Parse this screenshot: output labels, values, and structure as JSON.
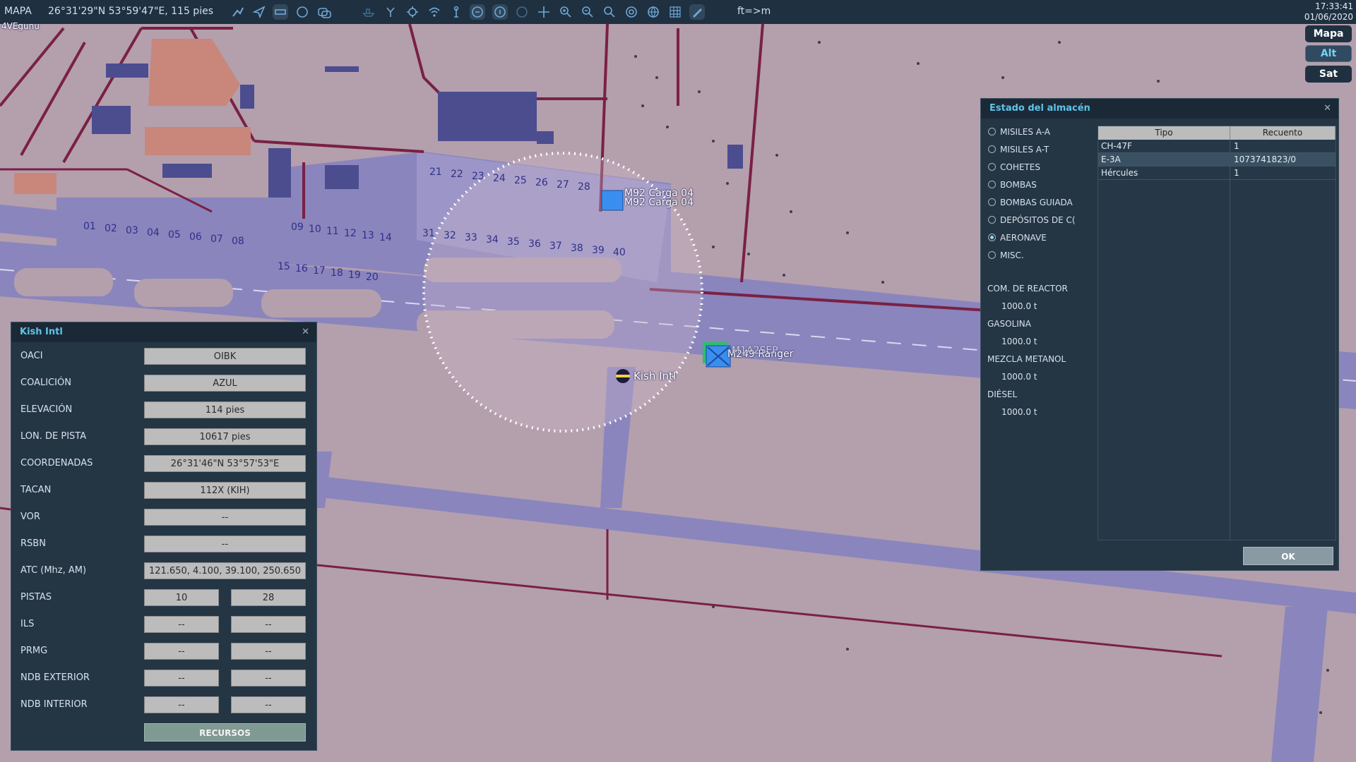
{
  "topbar": {
    "app_title": "MAPA",
    "cursor_position": "26°31'29\"N 53°59'47\"E, 115 pies",
    "unit_toggle": "ft=>m",
    "time": "17:33:41",
    "date": "01/06/2020"
  },
  "map": {
    "mode_buttons": {
      "map": "Mapa",
      "alt": "Alt",
      "sat": "Sat",
      "active": "Alt"
    },
    "corner_label": "4VEgunu",
    "airfield_label": "Kish Intl",
    "unit_labels": [
      "M92 Carga 04",
      "M92 Carga 04",
      "M249 Ranger",
      "M1A2SEP"
    ],
    "parking_spots": [
      "01",
      "02",
      "03",
      "04",
      "05",
      "06",
      "07",
      "08",
      "09",
      "10",
      "11",
      "12",
      "13",
      "14",
      "15",
      "16",
      "17",
      "18",
      "19",
      "20",
      "21",
      "22",
      "23",
      "24",
      "25",
      "26",
      "27",
      "28",
      "31",
      "32",
      "33",
      "34",
      "35",
      "36",
      "37",
      "38",
      "39",
      "40"
    ],
    "colors": {
      "terrain": "#b49fad",
      "apron": "#8a85bd",
      "roads": "#7a2045",
      "buildings": "#4c4d8f"
    }
  },
  "airport_panel": {
    "title": "Kish Intl",
    "fields": {
      "oaci": {
        "label": "OACI",
        "value": "OIBK"
      },
      "coalition": {
        "label": "COALICIÓN",
        "value": "AZUL"
      },
      "elevation": {
        "label": "ELEVACIÓN",
        "value": "114 pies"
      },
      "runway_length": {
        "label": "LON. DE PISTA",
        "value": "10617 pies"
      },
      "coordinates": {
        "label": "COORDENADAS",
        "value": "26°31'46\"N 53°57'53\"E"
      },
      "tacan": {
        "label": "TACAN",
        "value": "112X (KIH)"
      },
      "vor": {
        "label": "VOR",
        "value": "--"
      },
      "rsbn": {
        "label": "RSBN",
        "value": "--"
      },
      "atc": {
        "label": "ATC  (Mhz, AM)",
        "value": "121.650, 4.100, 39.100, 250.650"
      },
      "runways": {
        "label": "PISTAS",
        "value_a": "10",
        "value_b": "28"
      },
      "ils": {
        "label": "ILS",
        "value_a": "--",
        "value_b": "--"
      },
      "prmg": {
        "label": "PRMG",
        "value_a": "--",
        "value_b": "--"
      },
      "ndb_outer": {
        "label": "NDB EXTERIOR",
        "value_a": "--",
        "value_b": "--"
      },
      "ndb_inner": {
        "label": "NDB INTERIOR",
        "value_a": "--",
        "value_b": "--"
      }
    },
    "resources_button": "RECURSOS"
  },
  "warehouse_panel": {
    "title": "Estado del almacén",
    "categories": [
      {
        "label": "MISILES A-A",
        "selected": false
      },
      {
        "label": "MISILES A-T",
        "selected": false
      },
      {
        "label": "COHETES",
        "selected": false
      },
      {
        "label": "BOMBAS",
        "selected": false
      },
      {
        "label": "BOMBAS GUIADA",
        "selected": false
      },
      {
        "label": "DEPÓSITOS DE C(",
        "selected": false
      },
      {
        "label": "AERONAVE",
        "selected": true
      },
      {
        "label": "MISC.",
        "selected": false
      }
    ],
    "fuel": [
      {
        "label": "COM. DE REACTOR",
        "value": "1000.0 t"
      },
      {
        "label": "GASOLINA",
        "value": "1000.0 t"
      },
      {
        "label": "MEZCLA METANOL",
        "value": "1000.0 t"
      },
      {
        "label": "DIÉSEL",
        "value": "1000.0 t"
      }
    ],
    "table": {
      "headers": [
        "Tipo",
        "Recuento"
      ],
      "rows": [
        {
          "type": "CH-47F",
          "count": "1"
        },
        {
          "type": "E-3A",
          "count": "1073741823/0"
        },
        {
          "type": "Hércules",
          "count": "1"
        }
      ]
    },
    "ok_button": "OK"
  }
}
